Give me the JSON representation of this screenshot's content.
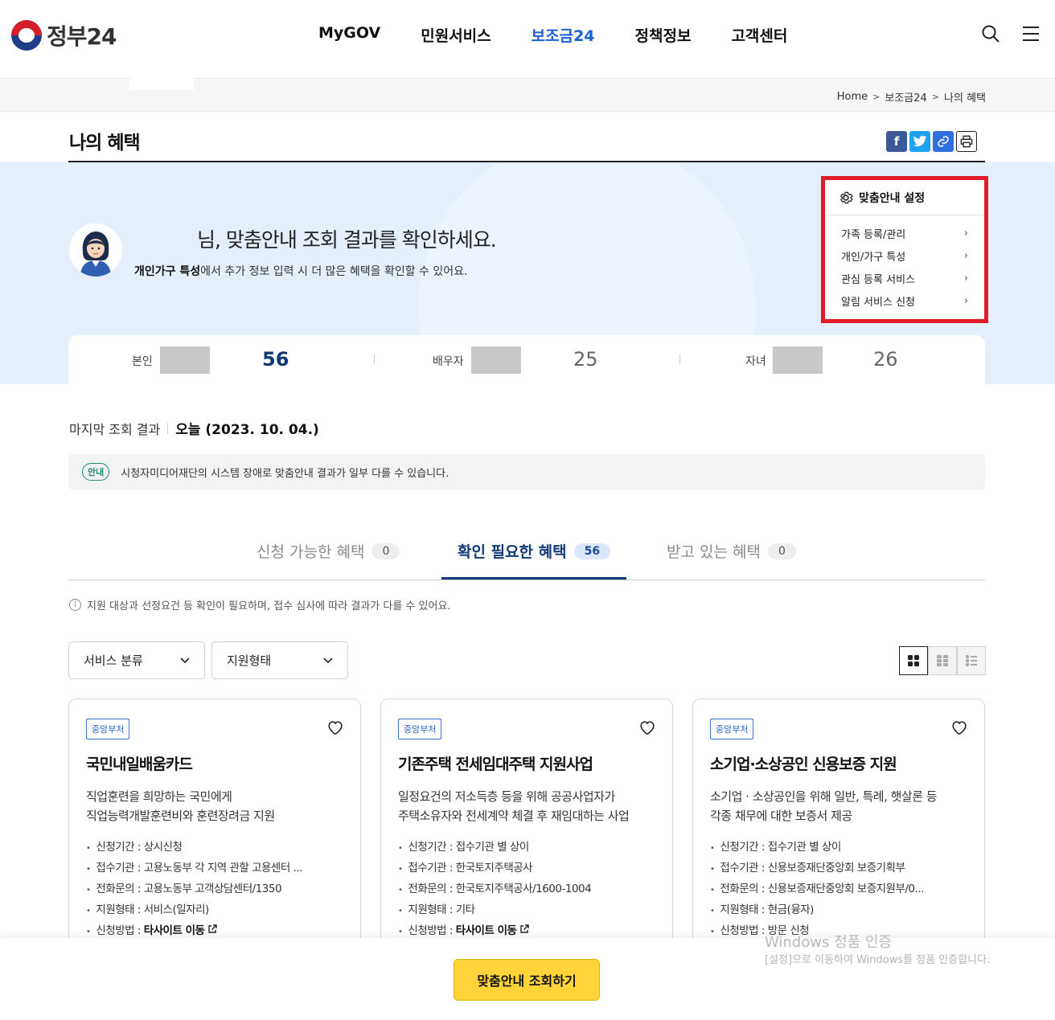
{
  "header": {
    "logo_text": "정부24",
    "nav": [
      "MyGOV",
      "민원서비스",
      "보조금24",
      "정책정보",
      "고객센터"
    ],
    "active_nav": "보조금24"
  },
  "breadcrumb": [
    "Home",
    "보조금24",
    "나의 혜택"
  ],
  "page_title": "나의 혜택",
  "share": {
    "facebook": "f",
    "twitter": "t",
    "link": "🔗",
    "print": "⎙"
  },
  "hero": {
    "title_suffix": "님, 맞춤안내 조회 결과를 확인하세요.",
    "sub_bold": "개인가구 특성",
    "sub_rest": "에서 추가 정보 입력 시 더 많은 혜택을 확인할 수 있어요."
  },
  "settings": {
    "title": "맞춤안내 설정",
    "items": [
      "가족 등록/관리",
      "개인/가구 특성",
      "관심 등록 서비스",
      "알림 서비스 신청"
    ],
    "highlight_color": "#e21b2a"
  },
  "counts": [
    {
      "label": "본인",
      "value": "56"
    },
    {
      "label": "배우자",
      "value": "25"
    },
    {
      "label": "자녀",
      "value": "26"
    }
  ],
  "last_query": {
    "label": "마지막 조회 결과",
    "value": "오늘 (2023. 10. 04.)"
  },
  "notice": {
    "tag": "안내",
    "text": "시청자미디어재단의 시스템 장애로 맞춤안내 결과가 일부 다를 수 있습니다."
  },
  "tabs": [
    {
      "label": "신청 가능한 혜택",
      "count": "0"
    },
    {
      "label": "확인 필요한 혜택",
      "count": "56"
    },
    {
      "label": "받고 있는 혜택",
      "count": "0"
    }
  ],
  "info_line": "지원 대상과 선정요건 등 확인이 필요하며, 접수 심사에 따라 결과가 다를 수 있어요.",
  "filters": {
    "service_category": "서비스 분류",
    "support_type": "지원형태"
  },
  "cards": [
    {
      "badge": "중앙부처",
      "title": "국민내일배움카드",
      "desc1": "직업훈련을 희망하는 국민에게",
      "desc2": "직업능력개발훈련비와 훈련장려금 지원",
      "period": "신청기간 : 상시신청",
      "agency": "접수기관 : 고용노동부 각 지역 관할 고용센터 ...",
      "contact": "전화문의 : 고용노동부 고객상담센터/1350",
      "type": "지원형태 : 서비스(일자리)",
      "method_label": "신청방법 : ",
      "method_value": "타사이트 이동"
    },
    {
      "badge": "중앙부처",
      "title": "기존주택 전세임대주택 지원사업",
      "desc1": "일정요건의 저소득층 등을 위해 공공사업자가",
      "desc2": "주택소유자와 전세계약 체결 후 재임대하는 사업",
      "period": "신청기간 : 접수기관 별 상이",
      "agency": "접수기관 : 한국토지주택공사",
      "contact": "전화문의 : 한국토지주택공사/1600-1004",
      "type": "지원형태 : 기타",
      "method_label": "신청방법 : ",
      "method_value": "타사이트 이동"
    },
    {
      "badge": "중앙부처",
      "title": "소기업·소상공인 신용보증 지원",
      "desc1": "소기업 · 소상공인을 위해 일반, 특례, 햇살론 등",
      "desc2": "각종 채무에 대한 보증서 제공",
      "period": "신청기간 : 접수기관 별 상이",
      "agency": "접수기관 : 신용보증재단중앙회 보증기획부",
      "contact": "전화문의 : 신용보증재단중앙회 보증지원부/0...",
      "type": "지원형태 : 현금(융자)",
      "method_label": "신청방법 : ",
      "method_value": "방문 신청"
    }
  ],
  "cta_label": "맞춤안내 조회하기",
  "watermark": {
    "line1": "Windows 정품 인증",
    "line2": "[설정]으로 이동하여 Windows를 정품 인증합니다."
  }
}
